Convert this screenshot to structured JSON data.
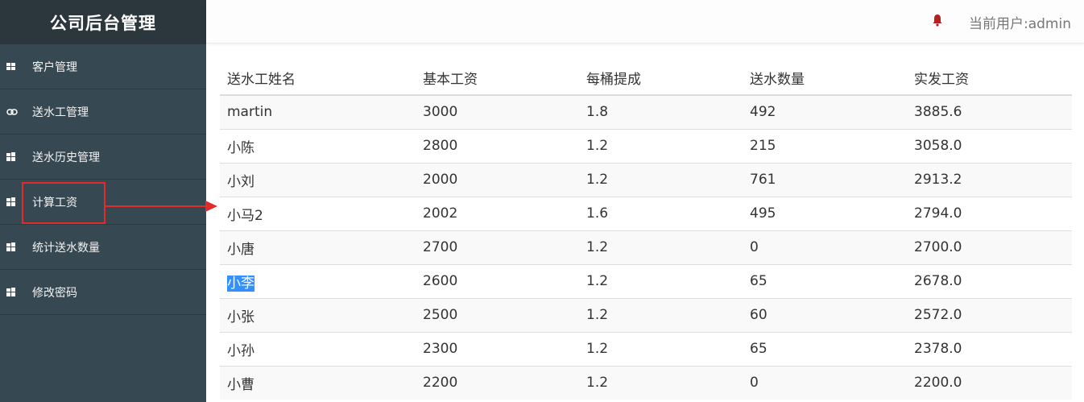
{
  "app": {
    "title": "公司后台管理"
  },
  "sidebar": {
    "items": [
      {
        "label": "客户管理",
        "icon": "grid-icon"
      },
      {
        "label": "送水工管理",
        "icon": "link-icon"
      },
      {
        "label": "送水历史管理",
        "icon": "puzzle-icon"
      },
      {
        "label": "计算工资",
        "icon": "puzzle-icon"
      },
      {
        "label": "统计送水数量",
        "icon": "puzzle-icon"
      },
      {
        "label": "修改密码",
        "icon": "puzzle-icon"
      }
    ]
  },
  "header": {
    "user_text": "当前用户:admin"
  },
  "table": {
    "headers": [
      "送水工姓名",
      "基本工资",
      "每桶提成",
      "送水数量",
      "实发工资"
    ],
    "rows": [
      [
        "martin",
        "3000",
        "1.8",
        "492",
        "3885.6"
      ],
      [
        "小陈",
        "2800",
        "1.2",
        "215",
        "3058.0"
      ],
      [
        "小刘",
        "2000",
        "1.2",
        "761",
        "2913.2"
      ],
      [
        "小马2",
        "2002",
        "1.6",
        "495",
        "2794.0"
      ],
      [
        "小唐",
        "2700",
        "1.2",
        "0",
        "2700.0"
      ],
      [
        "小李",
        "2600",
        "1.2",
        "65",
        "2678.0"
      ],
      [
        "小张",
        "2500",
        "1.2",
        "60",
        "2572.0"
      ],
      [
        "小孙",
        "2300",
        "1.2",
        "65",
        "2378.0"
      ],
      [
        "小曹",
        "2200",
        "1.2",
        "0",
        "2200.0"
      ]
    ]
  },
  "colors": {
    "sidebar": "#364851",
    "brand": "#2b373d",
    "annotation": "#e22b2b",
    "bell": "#b22222",
    "selection": "#3390ff"
  }
}
